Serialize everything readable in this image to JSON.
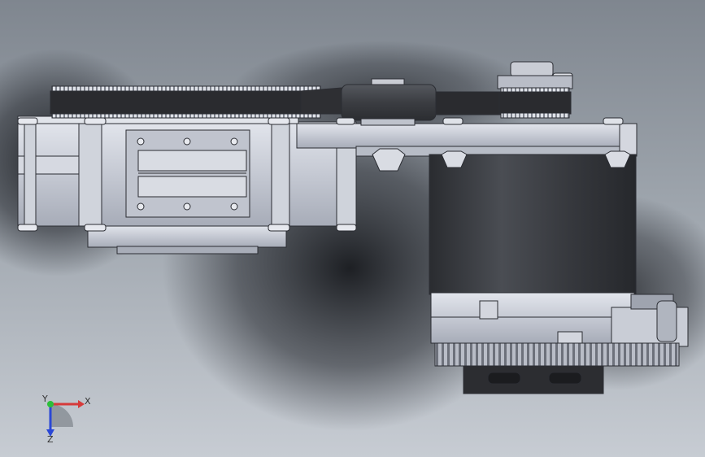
{
  "viewport": {
    "background_top": "#7b828d",
    "background_mid": "#9aa1aa",
    "background_bottom": "#c4c9d0",
    "shadow_color": "#1e2024"
  },
  "model": {
    "part_color": "#c8ccd6",
    "part_edge": "#2b2d33",
    "motor_color": "#34363b",
    "belt_color": "#2a2b2f"
  },
  "triad": {
    "x_label": "X",
    "y_label": "Y",
    "z_label": "Z",
    "x_color": "#d63a3a",
    "y_color": "#2cbf3a",
    "z_color": "#2a47d6"
  }
}
